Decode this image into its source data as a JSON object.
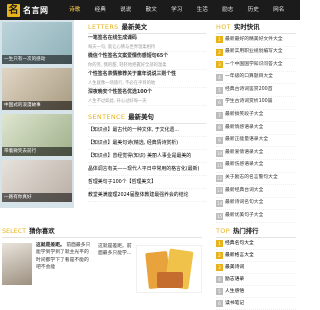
{
  "brand": {
    "logo_glyph": "名",
    "name": "名言网"
  },
  "nav": {
    "items": [
      "诗歌",
      "经典",
      "说说",
      "散文",
      "学习",
      "生活",
      "励志",
      "历史",
      "网名"
    ],
    "active_index": 0
  },
  "banner": {
    "captions": [
      "一生只有一次的感动",
      "中国式的浪漫故事",
      "带着微笑去前行",
      "一路有你真好"
    ]
  },
  "latest": {
    "en": "LETTERS",
    "cn": "最新美文",
    "items": [
      {
        "title": "一笔签名在线生成课码",
        "sub": "每天一句, 就让心情与世界温柔相待"
      },
      {
        "title": "微信个性签名文案爱情伤感短句65个",
        "sub": "你的笑, 我的甜, 轻轻地把握好全部的温柔"
      },
      {
        "title": "个性签名表情推荐关于童年说说三则个性",
        "sub": "人生就像一场旅行, 不必在乎目的地"
      },
      {
        "title": "深夜晚安个性签名优选100个",
        "sub": "人生不过如此, 开心过好每一天"
      }
    ]
  },
  "sentence": {
    "en": "SENTENCE",
    "cn": "最新美句",
    "items": [
      "【知识点】最古代的一种文体, 于文化遗...",
      "【知识点】最美句诗(精选, 经典情诗赏析)",
      "【知识点】曾经觉得(知识) 美丽人事业是最美的",
      "晶体调言有关——现代人平日中常用的格言化(最新)",
      "哲理美句子100个【哲理美文】",
      "教堂美满座理2024届整体教建最强养会的结论"
    ]
  },
  "hot": {
    "en": "HOT",
    "cn": "实时快讯",
    "items": [
      "最新最好的精美好文件大全",
      "最新实用职业规划编写大全",
      "一个中国国学知识问答大全",
      "一年级的口算题目大全",
      "经典古诗词鉴赏200首",
      "学生古诗词赏析100篇",
      "最新搞笑段子大全",
      "最新情感语录大全",
      "最新正能量语录大全",
      "最新爱情语录大全",
      "最新伤感语录大全",
      "关于励志的名言警句大全",
      "最新经典台词大全",
      "最新诗词名句大全",
      "最新优美句子大全"
    ]
  },
  "select": {
    "en": "SELECT",
    "cn": "猜你喜欢",
    "left_title": "这就是差距。",
    "left_text": "前面最多只能学到学到了就主光平的时间都学下了看是不能的吧不会能",
    "right_text": "这就是差距。前面最多只能学..."
  },
  "tags": {
    "en": "TOP",
    "cn": "热门排行",
    "items": [
      "经典名句大全",
      "最新格言大全",
      "最美诗词",
      "励志语录",
      "人生感悟",
      "读书笔记"
    ]
  }
}
